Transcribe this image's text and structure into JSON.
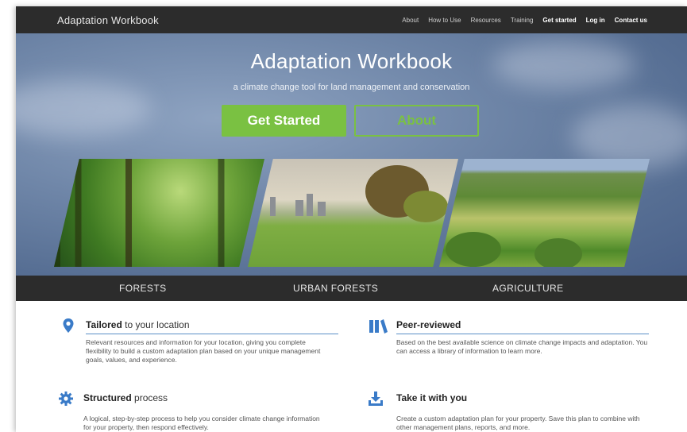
{
  "nav": {
    "brand": "Adaptation Workbook",
    "links": [
      "About",
      "How to Use",
      "Resources",
      "Training",
      "Get started",
      "Log in",
      "Contact us"
    ]
  },
  "hero": {
    "title": "Adaptation Workbook",
    "subtitle": "a climate change tool for land management and conservation",
    "get_started": "Get Started",
    "about": "About"
  },
  "categories": [
    "FORESTS",
    "URBAN FORESTS",
    "AGRICULTURE"
  ],
  "features": {
    "tailored": {
      "title_bold": "Tailored",
      "title_rest": " to your location",
      "desc": "Relevant resources and information for your location, giving you complete flexibility to build a custom adaptation plan based on your unique management goals, values, and experience."
    },
    "peer": {
      "title_bold": "Peer-reviewed",
      "title_rest": "",
      "desc": "Based on the best available science on climate change impacts and adaptation. You can access a library of information to learn more."
    },
    "structured": {
      "title_bold": "Structured",
      "title_rest": " process",
      "desc": "A logical, step-by-step process to help you consider climate change information for your property, then respond effectively."
    },
    "take": {
      "title_bold": "Take it with you",
      "title_rest": "",
      "desc": "Create a custom adaptation plan for your property. Save this plan to combine with other management plans, reports, and more."
    }
  },
  "colors": {
    "accent_green": "#7ac142",
    "nav_bg": "#2c2c2c",
    "icon_blue": "#3a7bc8"
  }
}
